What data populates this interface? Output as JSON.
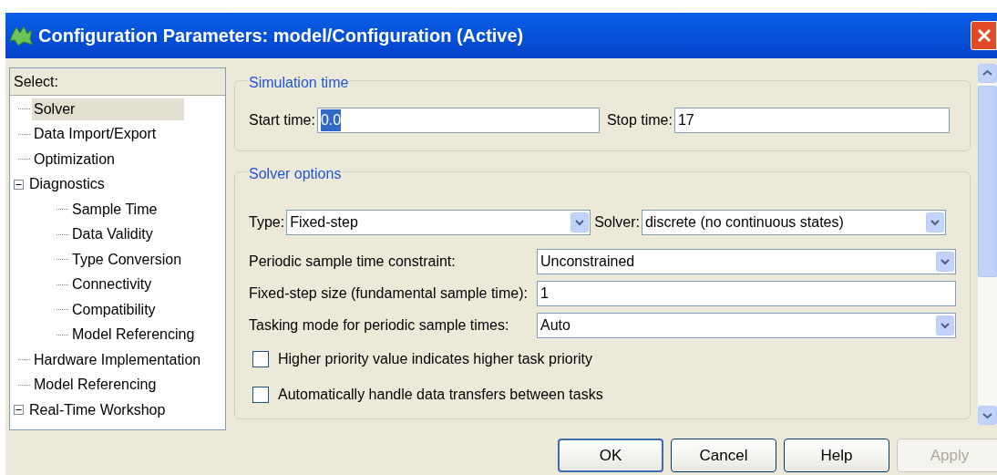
{
  "window": {
    "title": "Configuration Parameters: model/Configuration (Active)"
  },
  "tree": {
    "header": "Select:",
    "items": [
      {
        "label": "Solver",
        "selected": true
      },
      {
        "label": "Data Import/Export",
        "selected": false
      },
      {
        "label": "Optimization",
        "selected": false
      },
      {
        "label": "Diagnostics",
        "selected": false,
        "expanded": true,
        "children": [
          {
            "label": "Sample Time",
            "selected": false
          },
          {
            "label": "Data Validity",
            "selected": false
          },
          {
            "label": "Type Conversion",
            "selected": false
          },
          {
            "label": "Connectivity",
            "selected": false
          },
          {
            "label": "Compatibility",
            "selected": false
          },
          {
            "label": "Model Referencing",
            "selected": false
          }
        ]
      },
      {
        "label": "Hardware Implementation",
        "selected": false
      },
      {
        "label": "Model Referencing",
        "selected": false
      },
      {
        "label": "Real-Time Workshop",
        "selected": false,
        "expanded": true
      }
    ]
  },
  "simulation_time": {
    "title": "Simulation time",
    "start_label": "Start time:",
    "start_value": "0.0",
    "start_highlighted": true,
    "stop_label": "Stop time:",
    "stop_value": "17"
  },
  "solver_options": {
    "title": "Solver options",
    "type_label": "Type:",
    "type_value": "Fixed-step",
    "solver_label": "Solver:",
    "solver_value": "discrete (no continuous states)",
    "rows": [
      {
        "kind": "dropdown",
        "label": "Periodic sample time constraint:",
        "value": "Unconstrained"
      },
      {
        "kind": "text",
        "label": "Fixed-step size (fundamental sample time):",
        "value": "1"
      },
      {
        "kind": "dropdown",
        "label": "Tasking mode for periodic sample times:",
        "value": "Auto"
      },
      {
        "kind": "checkbox",
        "label": "Higher priority value indicates higher task priority",
        "checked": false
      },
      {
        "kind": "checkbox",
        "label": "Automatically handle data transfers between tasks",
        "checked": false
      }
    ]
  },
  "buttons": [
    {
      "label": "OK",
      "disabled": false,
      "default": true
    },
    {
      "label": "Cancel",
      "disabled": false
    },
    {
      "label": "Help",
      "disabled": false
    },
    {
      "label": "Apply",
      "disabled": true
    }
  ]
}
